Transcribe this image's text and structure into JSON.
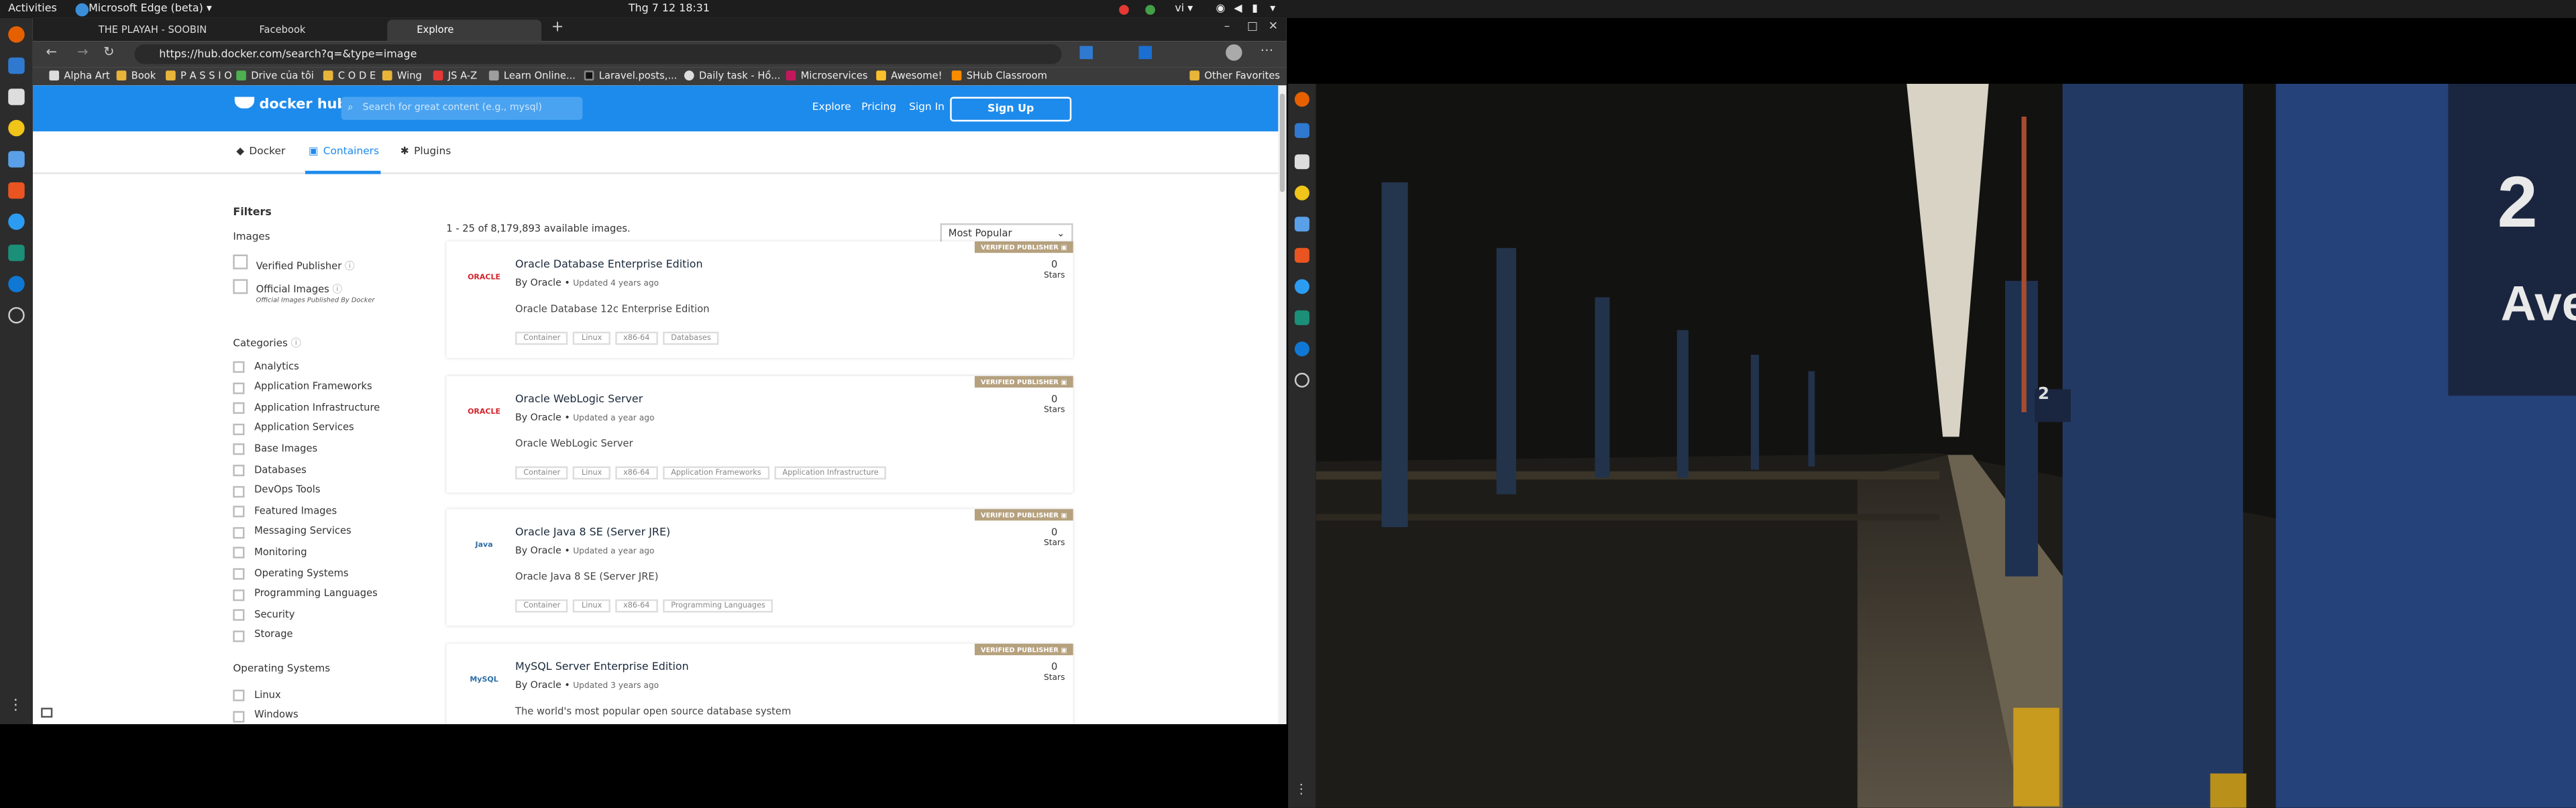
{
  "system": {
    "activities": "Activities",
    "app": "Microsoft Edge (beta) ▾",
    "clock": "Thg 7 12  18:31",
    "lang": "vi ▾"
  },
  "tabs": [
    {
      "label": "THE PLAYAH - SOOBIN"
    },
    {
      "label": "Facebook"
    },
    {
      "label": "Explore"
    }
  ],
  "address": "https://hub.docker.com/search?q=&type=image",
  "favorites": [
    {
      "label": "Alpha Art",
      "color": "#d0d0d0"
    },
    {
      "label": "Book",
      "color": "#e8b43a"
    },
    {
      "label": "P A S S I O",
      "color": "#e8b43a"
    },
    {
      "label": "Drive của tôi",
      "color": "#4caf50"
    },
    {
      "label": "C O D E",
      "color": "#e8b43a"
    },
    {
      "label": "Wing",
      "color": "#e8b43a"
    },
    {
      "label": "JS A-Z",
      "color": "#e53935"
    },
    {
      "label": "Learn Online...",
      "color": "#9e9e9e"
    },
    {
      "label": "Laravel.posts,...",
      "color": "#222"
    },
    {
      "label": "Daily task - Hồ...",
      "color": "#ddd"
    },
    {
      "label": "Microservices",
      "color": "#c2185b"
    },
    {
      "label": "Awesome!",
      "color": "#fbc02d"
    },
    {
      "label": "SHub Classroom",
      "color": "#fb8c00"
    }
  ],
  "other_favorites": "Other Favorites",
  "header": {
    "logo": "docker hub",
    "search_placeholder": "Search for great content (e.g., mysql)",
    "explore": "Explore",
    "pricing": "Pricing",
    "signin": "Sign In",
    "signup": "Sign Up"
  },
  "subnav": [
    {
      "label": "Docker"
    },
    {
      "label": "Containers"
    },
    {
      "label": "Plugins"
    }
  ],
  "filters": {
    "title": "Filters",
    "images_title": "Images",
    "verified": "Verified Publisher",
    "official": "Official Images",
    "official_sub": "Official Images Published By Docker",
    "categories_title": "Categories",
    "categories": [
      "Analytics",
      "Application Frameworks",
      "Application Infrastructure",
      "Application Services",
      "Base Images",
      "Databases",
      "DevOps Tools",
      "Featured Images",
      "Messaging Services",
      "Monitoring",
      "Operating Systems",
      "Programming Languages",
      "Security",
      "Storage"
    ],
    "os_title": "Operating Systems",
    "os": [
      "Linux",
      "Windows"
    ]
  },
  "results_count": "1 - 25 of 8,179,893 available images.",
  "sort": "Most Popular",
  "cards": [
    {
      "badge": "VERIFIED PUBLISHER",
      "name": "Oracle Database Enterprise Edition",
      "by": "By Oracle",
      "updated": "Updated 4 years ago",
      "desc": "Oracle Database 12c Enterprise Edition",
      "tags": [
        "Container",
        "Linux",
        "x86-64",
        "Databases"
      ],
      "stars": "0",
      "stars_label": "Stars",
      "logo": "ORACLE"
    },
    {
      "badge": "VERIFIED PUBLISHER",
      "name": "Oracle WebLogic Server",
      "by": "By Oracle",
      "updated": "Updated a year ago",
      "desc": "Oracle WebLogic Server",
      "tags": [
        "Container",
        "Linux",
        "x86-64",
        "Application Frameworks",
        "Application Infrastructure"
      ],
      "stars": "0",
      "stars_label": "Stars",
      "logo": "ORACLE"
    },
    {
      "badge": "VERIFIED PUBLISHER",
      "name": "Oracle Java 8 SE (Server JRE)",
      "by": "By Oracle",
      "updated": "Updated a year ago",
      "desc": "Oracle Java 8 SE (Server JRE)",
      "tags": [
        "Container",
        "Linux",
        "x86-64",
        "Programming Languages"
      ],
      "stars": "0",
      "stars_label": "Stars",
      "logo": "Java"
    },
    {
      "badge": "VERIFIED PUBLISHER",
      "name": "MySQL Server Enterprise Edition",
      "by": "By Oracle",
      "updated": "Updated 3 years ago",
      "desc": "The world's most popular open source database system",
      "tags": [],
      "stars": "0",
      "stars_label": "Stars",
      "logo": "MySQL"
    }
  ],
  "wallpaper": {
    "sign_big": "2",
    "sign_text": "Ave",
    "sign_small": "2"
  }
}
